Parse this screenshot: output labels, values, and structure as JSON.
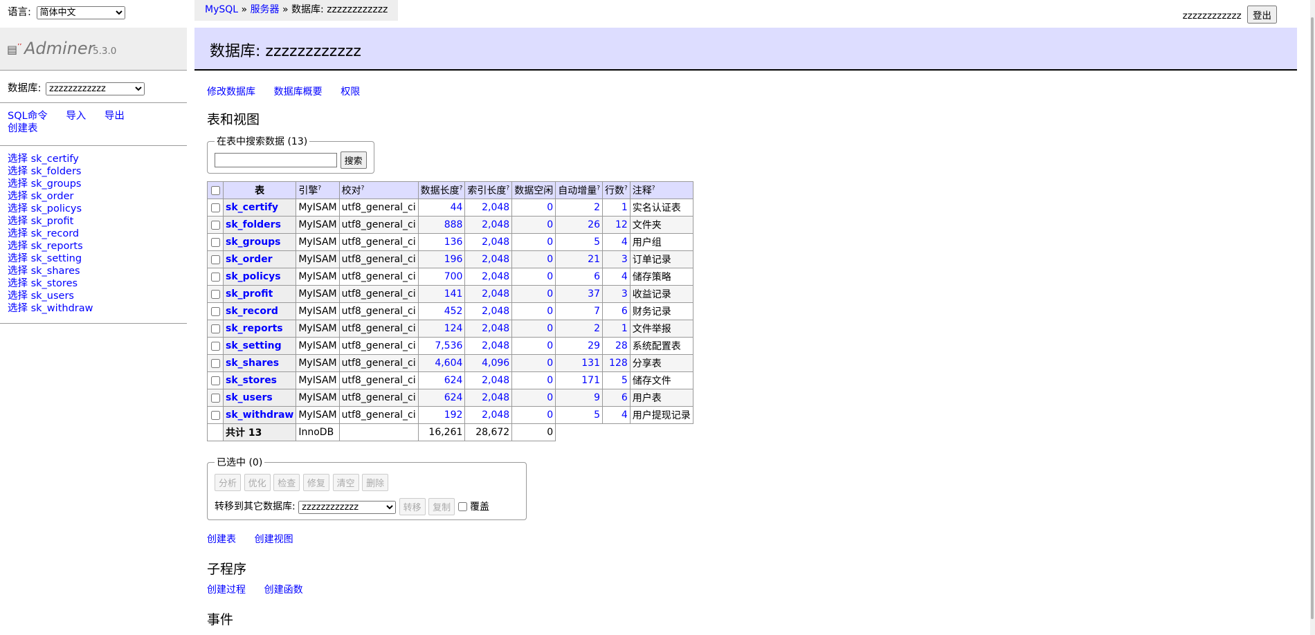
{
  "lang": {
    "label": "语言:",
    "selected": "简体中文"
  },
  "logout": {
    "user": "zzzzzzzzzzzz",
    "button": "登出"
  },
  "breadcrumb": {
    "driver": "MySQL",
    "sep1": "»",
    "server": "服务器",
    "sep2": "»",
    "current": "数据库: zzzzzzzzzzzz"
  },
  "app": {
    "name": "Adminer",
    "version": "5.3.0"
  },
  "menu": {
    "db_label": "数据库:",
    "db_selected": "zzzzzzzzzzzz",
    "links": [
      "SQL命令",
      "导入",
      "导出",
      "创建表"
    ],
    "table_links": [
      "选择 sk_certify",
      "选择 sk_folders",
      "选择 sk_groups",
      "选择 sk_order",
      "选择 sk_policys",
      "选择 sk_profit",
      "选择 sk_record",
      "选择 sk_reports",
      "选择 sk_setting",
      "选择 sk_shares",
      "选择 sk_stores",
      "选择 sk_users",
      "选择 sk_withdraw"
    ]
  },
  "page": {
    "title": "数据库: zzzzzzzzzzzz"
  },
  "top_links": [
    "修改数据库",
    "数据库概要",
    "权限"
  ],
  "tables_heading": "表和视图",
  "search": {
    "legend": "在表中搜索数据 (13)",
    "button": "搜索",
    "value": ""
  },
  "table": {
    "headers": [
      "表",
      "引擎",
      "校对",
      "数据长度",
      "索引长度",
      "数据空闲",
      "自动增量",
      "行数",
      "注释"
    ],
    "rows": [
      [
        "sk_certify",
        "MyISAM",
        "utf8_general_ci",
        "44",
        "2,048",
        "0",
        "2",
        "1",
        "实名认证表"
      ],
      [
        "sk_folders",
        "MyISAM",
        "utf8_general_ci",
        "888",
        "2,048",
        "0",
        "26",
        "12",
        "文件夹"
      ],
      [
        "sk_groups",
        "MyISAM",
        "utf8_general_ci",
        "136",
        "2,048",
        "0",
        "5",
        "4",
        "用户组"
      ],
      [
        "sk_order",
        "MyISAM",
        "utf8_general_ci",
        "196",
        "2,048",
        "0",
        "21",
        "3",
        "订单记录"
      ],
      [
        "sk_policys",
        "MyISAM",
        "utf8_general_ci",
        "700",
        "2,048",
        "0",
        "6",
        "4",
        "储存策略"
      ],
      [
        "sk_profit",
        "MyISAM",
        "utf8_general_ci",
        "141",
        "2,048",
        "0",
        "37",
        "3",
        "收益记录"
      ],
      [
        "sk_record",
        "MyISAM",
        "utf8_general_ci",
        "452",
        "2,048",
        "0",
        "7",
        "6",
        "财务记录"
      ],
      [
        "sk_reports",
        "MyISAM",
        "utf8_general_ci",
        "124",
        "2,048",
        "0",
        "2",
        "1",
        "文件举报"
      ],
      [
        "sk_setting",
        "MyISAM",
        "utf8_general_ci",
        "7,536",
        "2,048",
        "0",
        "29",
        "28",
        "系统配置表"
      ],
      [
        "sk_shares",
        "MyISAM",
        "utf8_general_ci",
        "4,604",
        "4,096",
        "0",
        "131",
        "128",
        "分享表"
      ],
      [
        "sk_stores",
        "MyISAM",
        "utf8_general_ci",
        "624",
        "2,048",
        "0",
        "171",
        "5",
        "储存文件"
      ],
      [
        "sk_users",
        "MyISAM",
        "utf8_general_ci",
        "624",
        "2,048",
        "0",
        "9",
        "6",
        "用户表"
      ],
      [
        "sk_withdraw",
        "MyISAM",
        "utf8_general_ci",
        "192",
        "2,048",
        "0",
        "5",
        "4",
        "用户提现记录"
      ]
    ],
    "footer": [
      "共计 13",
      "InnoDB",
      "",
      "16,261",
      "28,672",
      "0"
    ]
  },
  "selected": {
    "legend": "已选中 (0)",
    "buttons": [
      "分析",
      "优化",
      "检查",
      "修复",
      "清空",
      "删除"
    ],
    "transfer_label": "转移到其它数据库:",
    "transfer_db": "zzzzzzzzzzzz",
    "move": "转移",
    "copy": "复制",
    "overwrite": "覆盖"
  },
  "bottom_links": [
    "创建表",
    "创建视图"
  ],
  "routines_heading": "子程序",
  "routine_links": [
    "创建过程",
    "创建函数"
  ],
  "events_heading": "事件"
}
